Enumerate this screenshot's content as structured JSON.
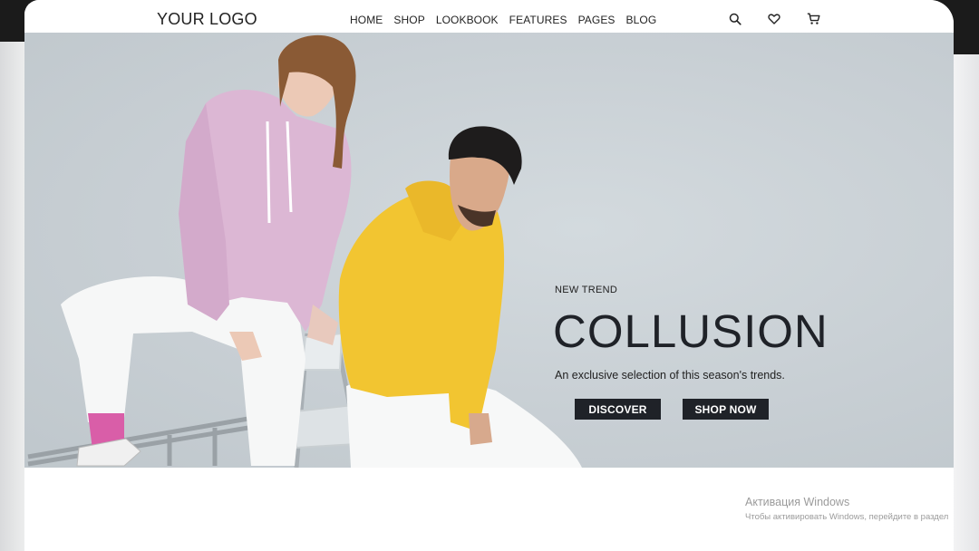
{
  "header": {
    "logo": "YOUR LOGO",
    "nav": [
      "HOME",
      "SHOP",
      "LOOKBOOK",
      "FEATURES",
      "PAGES",
      "BLOG"
    ],
    "icons": [
      "search-icon",
      "heart-icon",
      "cart-icon"
    ]
  },
  "hero": {
    "eyebrow": "NEW TREND",
    "title": "COLLUSION",
    "subtitle": "An exclusive selection of this season's trends.",
    "buttons": {
      "discover": "DISCOVER",
      "shop_now": "SHOP NOW"
    },
    "colors": {
      "background": "#c8cfd4",
      "button": "#1f2228",
      "hoodie_pink": "#d9b4d2",
      "hoodie_yellow": "#f2c531"
    }
  },
  "watermark": {
    "title": "Активация Windows",
    "subtitle": "Чтобы активировать Windows, перейдите в раздел"
  }
}
